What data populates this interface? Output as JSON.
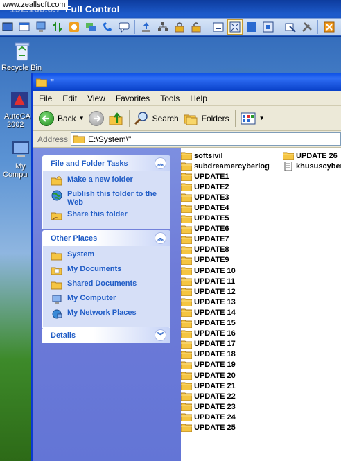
{
  "remote": {
    "credit": "www.zeallsoft.com",
    "ip": "192.168.0.7",
    "title": "Full Control"
  },
  "desktop": {
    "icons": [
      {
        "label": "Recycle Bin"
      },
      {
        "label": "AutoCA"
      },
      {
        "label": "2002"
      },
      {
        "label": "My"
      },
      {
        "label": "Compu"
      }
    ]
  },
  "window": {
    "title": "\"",
    "menu": [
      "File",
      "Edit",
      "View",
      "Favorites",
      "Tools",
      "Help"
    ],
    "toolbar": {
      "back": "Back",
      "search": "Search",
      "folders": "Folders"
    },
    "address": {
      "label": "Address",
      "value": "E:\\System\\\""
    }
  },
  "taskpane": {
    "file_tasks": {
      "title": "File and Folder Tasks",
      "items": [
        "Make a new folder",
        "Publish this folder to the Web",
        "Share this folder"
      ]
    },
    "other_places": {
      "title": "Other Places",
      "items": [
        "System",
        "My Documents",
        "Shared Documents",
        "My Computer",
        "My Network Places"
      ]
    },
    "details": {
      "title": "Details"
    }
  },
  "files": {
    "column1": [
      "softsivil",
      "subdreamercyberlog",
      "UPDATE1",
      "UPDATE2",
      "UPDATE3",
      "UPDATE4",
      "UPDATE5",
      "UPDATE6",
      "UPDATE7",
      "UPDATE8",
      "UPDATE9",
      "UPDATE 10",
      "UPDATE 11",
      "UPDATE 12",
      "UPDATE 13",
      "UPDATE 14",
      "UPDATE 15",
      "UPDATE 16",
      "UPDATE 17",
      "UPDATE 18",
      "UPDATE 19",
      "UPDATE 20",
      "UPDATE 21",
      "UPDATE 22",
      "UPDATE 23",
      "UPDATE 24",
      "UPDATE 25"
    ],
    "column2": [
      {
        "name": "UPDATE 26",
        "type": "folder"
      },
      {
        "name": "khususcyber",
        "type": "file"
      }
    ]
  },
  "colors": {
    "xp_blue": "#0a4ee4",
    "task_link": "#215dc6",
    "folder_yellow": "#f5c542"
  }
}
